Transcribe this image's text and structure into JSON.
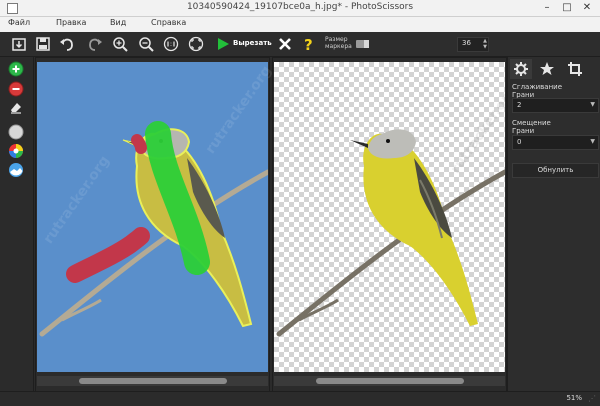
{
  "window": {
    "title": "10340590424_19107bce0a_h.jpg* - PhotoScissors"
  },
  "menu": [
    "Файл",
    "Правка",
    "Вид",
    "Справка"
  ],
  "toolbar": {
    "cut_label": "Вырезать",
    "marker_size_label_1": "Размер",
    "marker_size_label_2": "маркера",
    "marker_size_value": "36"
  },
  "right_panel": {
    "smoothing_label_1": "Сглаживание",
    "smoothing_label_2": "Грани",
    "smoothing_value": "2",
    "offset_label_1": "Смещение",
    "offset_label_2": "Грани",
    "offset_value": "0",
    "reset_button": "Обнулить"
  },
  "status": {
    "zoom": "51%"
  },
  "watermark": {
    "text": "rutracker.org"
  },
  "colors": {
    "accent_green": "#22c03a",
    "help_yellow": "#f2d21b",
    "canvas_blue": "#5a8fcb",
    "keep_brush_green": "#2ccf38",
    "remove_brush_red": "#c2374a",
    "edge_outline_yellow": "#e9f05a"
  },
  "icons": {
    "open": "open-file-icon",
    "save": "save-icon",
    "undo": "undo-icon",
    "redo": "redo-icon",
    "zoom_in": "zoom-in-icon",
    "zoom_out": "zoom-out-icon",
    "zoom_1to1": "zoom-1to1-icon",
    "zoom_fit": "zoom-fit-icon",
    "cut": "play-cut-icon",
    "clear": "close-icon",
    "help": "help-icon"
  }
}
